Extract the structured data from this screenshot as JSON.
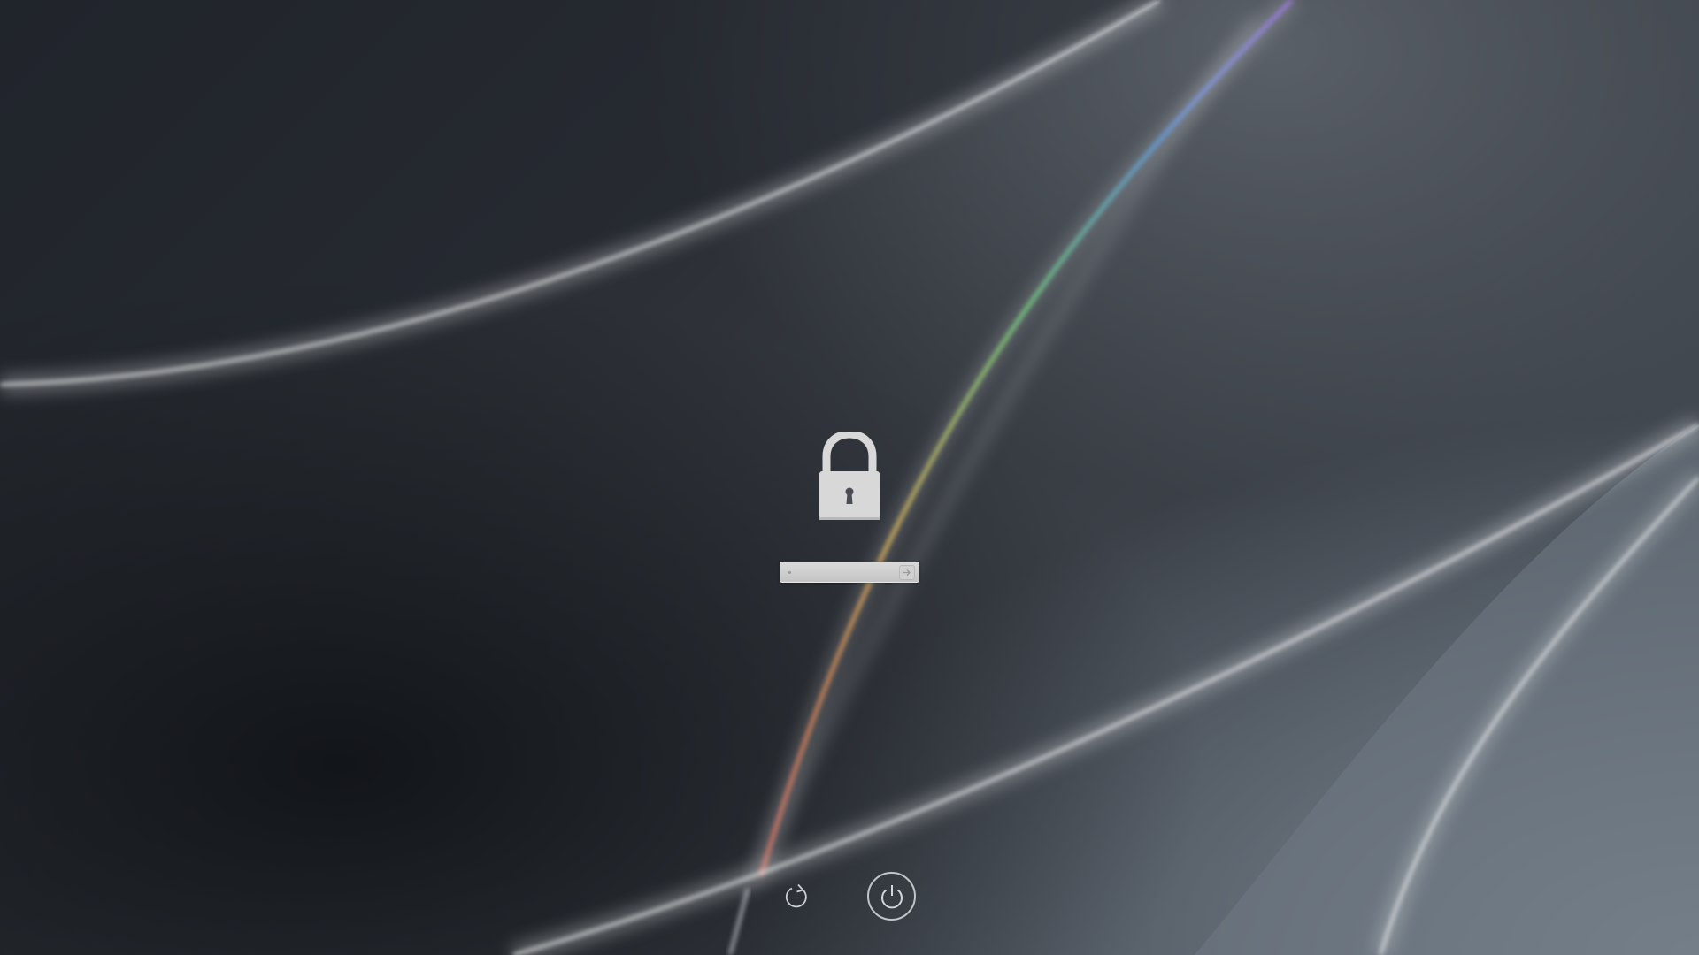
{
  "login": {
    "password_placeholder": "",
    "password_value": ""
  },
  "icons": {
    "lock": "lock-icon",
    "submit": "arrow-right-icon",
    "restart": "restart-icon",
    "shutdown": "power-icon"
  },
  "colors": {
    "icon": "#d8d8d8",
    "field_background": "#d0d0d0",
    "ring": "#dcdee1"
  }
}
